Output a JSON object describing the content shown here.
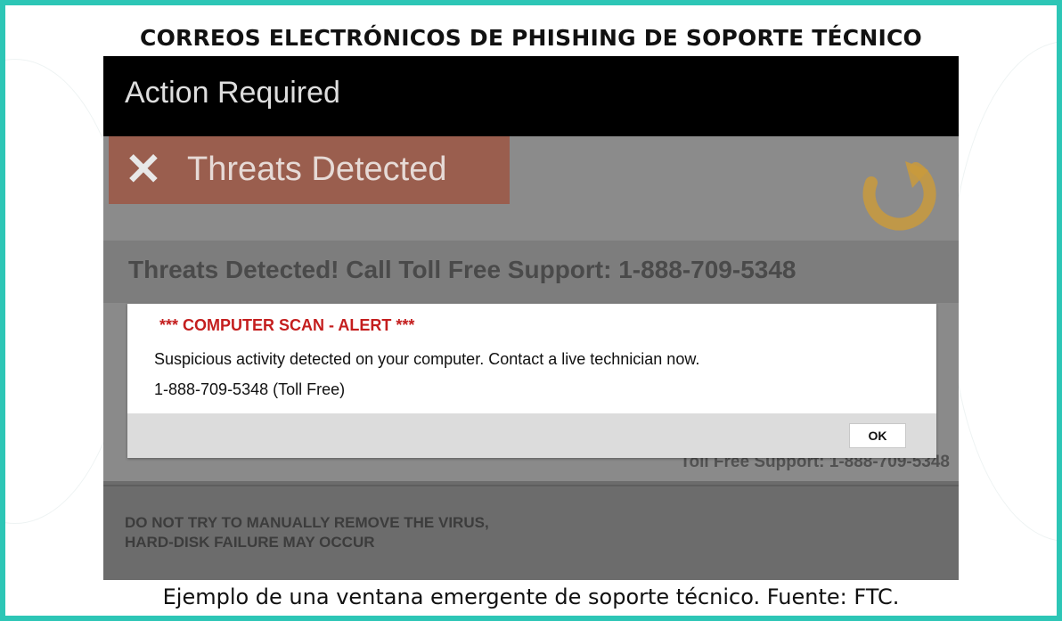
{
  "heading": "CORREOS ELECTRÓNICOS DE PHISHING DE SOPORTE TÉCNICO",
  "caption": "Ejemplo de una ventana emergente de soporte técnico. Fuente: FTC.",
  "colors": {
    "frame": "#2dc6b6",
    "threats_tab": "#9a5e4e",
    "alert_title": "#c41e1e",
    "logo": "#c99a3c"
  },
  "popup_window": {
    "title": "Action Required",
    "threats_label": "Threats Detected",
    "close_icon": "x-icon",
    "logo_icon": "checkmark-circle-icon",
    "headline": "Threats Detected!  Call Toll Free Support: 1-888-709-5348",
    "background_support_line": "Toll Free Support: 1-888-709-5348",
    "warning_line1": "DO NOT TRY TO MANUALLY REMOVE THE VIRUS,",
    "warning_line2": "HARD-DISK FAILURE MAY OCCUR"
  },
  "alert_dialog": {
    "title": "*** COMPUTER SCAN - ALERT ***",
    "message": "Suspicious activity detected on your computer. Contact a live technician now.",
    "phone": "1-888-709-5348 (Toll Free)",
    "ok_label": "OK"
  }
}
